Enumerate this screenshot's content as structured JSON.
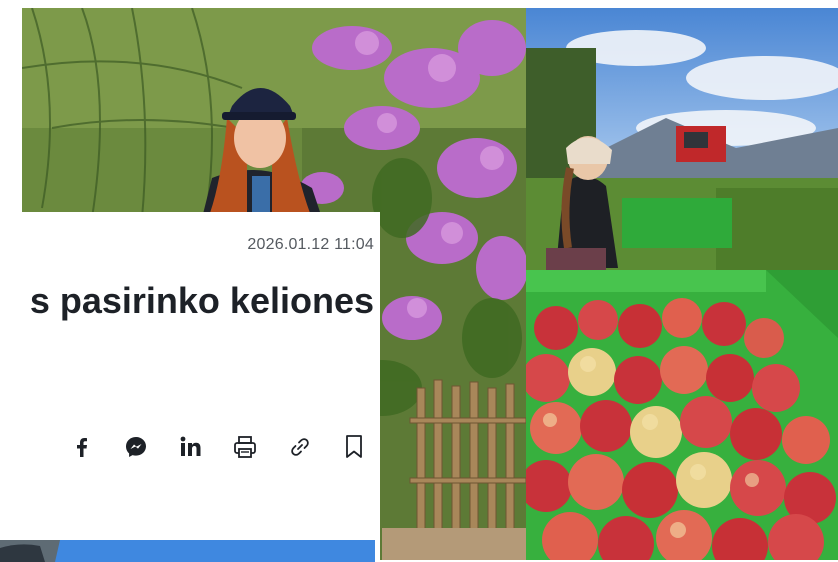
{
  "article": {
    "timestamp": "2026.01.12 11:04",
    "headline_fragment": "s pasirinko keliones"
  },
  "share_bar": {
    "buttons": [
      {
        "icon": "facebook-icon"
      },
      {
        "icon": "messenger-icon"
      },
      {
        "icon": "linkedin-icon"
      },
      {
        "icon": "print-icon"
      },
      {
        "icon": "copy-link-icon"
      },
      {
        "icon": "bookmark-icon"
      }
    ]
  },
  "colors": {
    "text_dark": "#1d2127",
    "text_muted": "#555a60",
    "apple_red": "#c8323a",
    "crate_green": "#2faa3a",
    "foliage_green": "#4f7a2c",
    "lilac": "#b96cc9"
  }
}
